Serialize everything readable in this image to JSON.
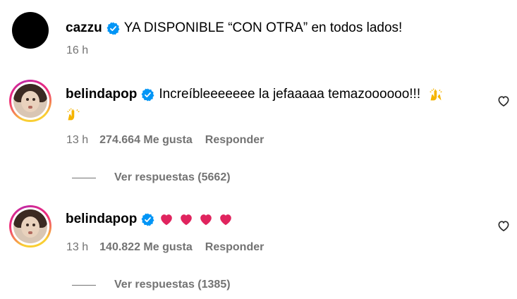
{
  "comments": [
    {
      "username": "cazzu",
      "text": "YA DISPONIBLE “CON OTRA” en todos lados!",
      "time": "16 h"
    },
    {
      "username": "belindapop",
      "text": "Increíbleeeeeee la jefaaaaa temazoooooo!!!",
      "emojis": [
        "raising-hands",
        "raising-hands"
      ],
      "time": "13 h",
      "likes": "274.664 Me gusta",
      "reply_label": "Responder",
      "view_replies": "Ver respuestas (5662)"
    },
    {
      "username": "belindapop",
      "emojis": [
        "red-heart",
        "red-heart",
        "red-heart",
        "red-heart"
      ],
      "time": "13 h",
      "likes": "140.822 Me gusta",
      "reply_label": "Responder",
      "view_replies": "Ver respuestas (1385)"
    }
  ],
  "colors": {
    "verified": "#0095f6",
    "secondary_text": "#737373",
    "heart": "#e0245e"
  }
}
